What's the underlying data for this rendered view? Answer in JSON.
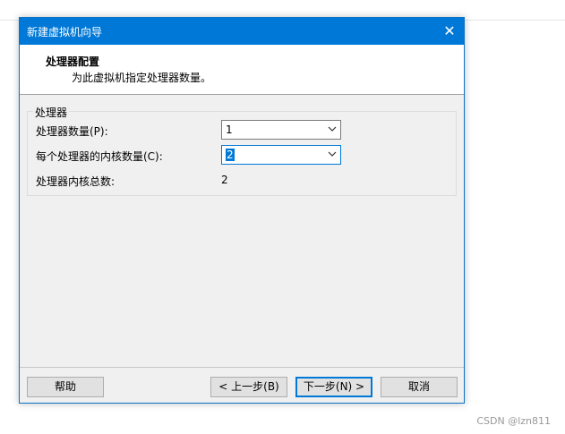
{
  "window": {
    "title": "新建虚拟机向导",
    "close_glyph": "✕"
  },
  "header": {
    "title": "处理器配置",
    "subtitle": "为此虚拟机指定处理器数量。"
  },
  "processors": {
    "group_label": "处理器",
    "count_label": "处理器数量(P):",
    "count_value": "1",
    "cores_label": "每个处理器的内核数量(C):",
    "cores_value": "2",
    "total_label": "处理器内核总数:",
    "total_value": "2"
  },
  "buttons": {
    "help": "帮助",
    "back": "< 上一步(B)",
    "next": "下一步(N) >",
    "cancel": "取消"
  },
  "watermark": "CSDN @lzn811",
  "colors": {
    "titlebar": "#0078d7",
    "dialog_bg": "#f0f0f0"
  }
}
